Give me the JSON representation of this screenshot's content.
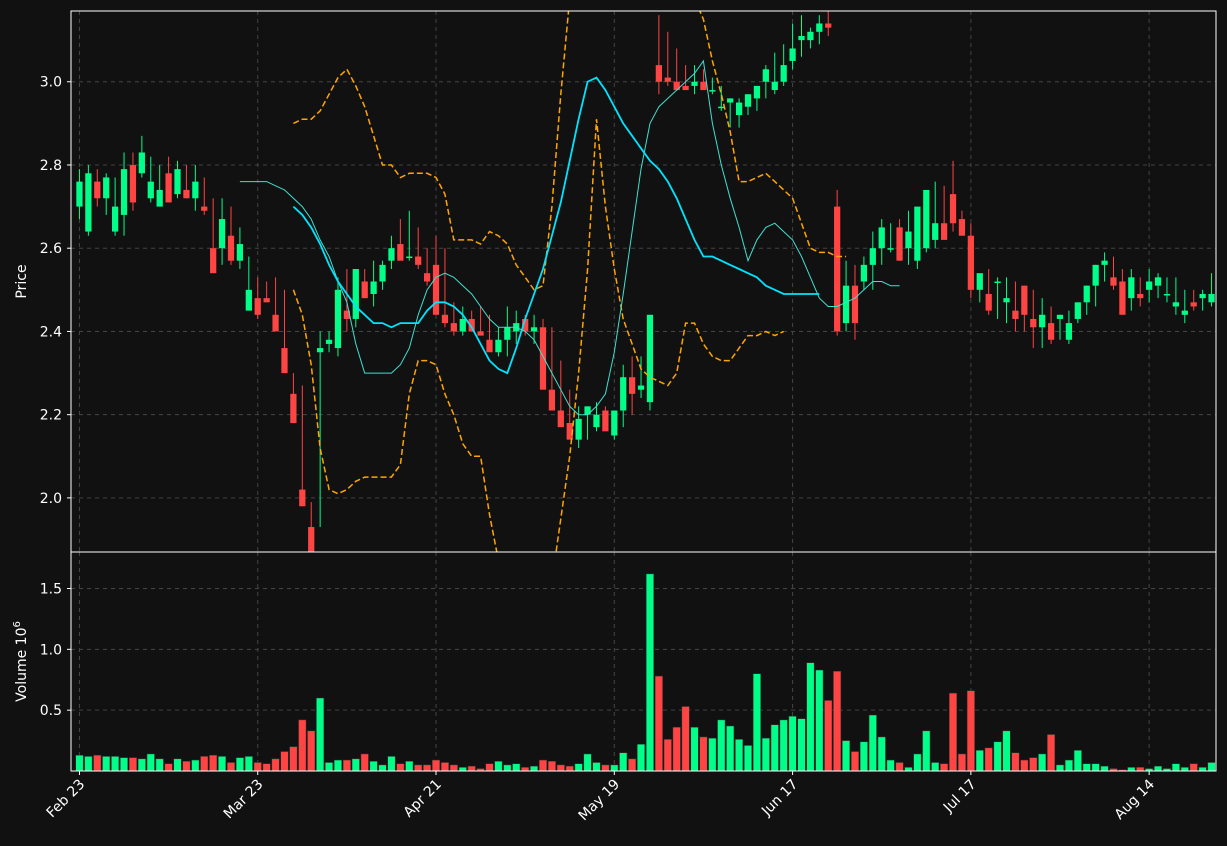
{
  "chart_data": [
    {
      "type": "candlestick",
      "ylabel": "Price",
      "ylim": [
        1.87,
        3.17
      ],
      "yticks": [
        2.0,
        2.2,
        2.4,
        2.6,
        2.8,
        3.0
      ],
      "xticks": [
        "Feb 23",
        "Mar 23",
        "Apr 21",
        "May 19",
        "Jun 17",
        "Jul 17",
        "Aug 14"
      ],
      "grid": true,
      "colors": {
        "up": "#00ff88",
        "down": "#ff4444",
        "ma_fast": "#40e0d0",
        "ma_slow": "#00e5ff",
        "bands": "#ffa500",
        "background": "#111111"
      },
      "open": [
        2.7,
        2.64,
        2.76,
        2.72,
        2.64,
        2.68,
        2.8,
        2.78,
        2.72,
        2.7,
        2.78,
        2.73,
        2.74,
        2.72,
        2.7,
        2.6,
        2.6,
        2.63,
        2.57,
        2.45,
        2.48,
        2.48,
        2.44,
        2.36,
        2.25,
        2.02,
        1.93,
        2.35,
        2.37,
        2.36,
        2.45,
        2.43,
        2.52,
        2.49,
        2.52,
        2.57,
        2.61,
        2.58,
        2.58,
        2.54,
        2.56,
        2.44,
        2.42,
        2.4,
        2.43,
        2.4,
        2.38,
        2.35,
        2.38,
        2.4,
        2.43,
        2.4,
        2.41,
        2.26,
        2.21,
        2.18,
        2.14,
        2.2,
        2.17,
        2.21,
        2.15,
        2.21,
        2.29,
        2.26,
        2.23,
        3.04,
        3.01,
        3.0,
        2.99,
        2.99,
        3.0,
        2.98,
        2.94,
        2.95,
        2.92,
        2.94,
        2.96,
        3.0,
        2.98,
        3.0,
        3.05,
        3.1,
        3.1,
        3.12,
        3.14,
        2.7,
        2.42,
        2.51,
        2.52,
        2.56,
        2.6,
        2.6,
        2.65,
        2.6,
        2.57,
        2.6,
        2.62,
        2.66,
        2.73,
        2.67,
        2.63,
        2.5,
        2.49,
        2.52,
        2.47,
        2.45,
        2.51,
        2.43,
        2.41,
        2.42,
        2.43,
        2.38,
        2.43,
        2.47,
        2.51,
        2.56,
        2.53,
        2.52,
        2.48,
        2.49,
        2.5,
        2.51,
        2.49,
        2.46,
        2.44,
        2.47,
        2.48,
        2.47
      ],
      "high": [
        2.79,
        2.8,
        2.79,
        2.78,
        2.77,
        2.83,
        2.83,
        2.87,
        2.82,
        2.8,
        2.82,
        2.81,
        2.8,
        2.8,
        2.77,
        2.72,
        2.72,
        2.7,
        2.65,
        2.58,
        2.53,
        2.52,
        2.53,
        2.5,
        2.3,
        2.27,
        1.99,
        2.4,
        2.4,
        2.53,
        2.55,
        2.54,
        2.55,
        2.57,
        2.57,
        2.63,
        2.67,
        2.69,
        2.65,
        2.6,
        2.63,
        2.6,
        2.47,
        2.46,
        2.45,
        2.46,
        2.44,
        2.41,
        2.46,
        2.45,
        2.44,
        2.44,
        2.43,
        2.41,
        2.33,
        2.26,
        2.22,
        2.22,
        2.23,
        2.22,
        2.21,
        2.32,
        2.34,
        2.34,
        2.44,
        3.16,
        3.12,
        3.08,
        3.04,
        3.04,
        3.03,
        3.01,
        2.99,
        2.96,
        2.96,
        2.97,
        2.99,
        3.04,
        3.07,
        3.09,
        3.14,
        3.16,
        3.13,
        3.16,
        3.17,
        2.74,
        2.57,
        2.56,
        2.58,
        2.64,
        2.67,
        2.66,
        2.67,
        2.69,
        2.64,
        2.71,
        2.76,
        2.75,
        2.81,
        2.69,
        2.66,
        2.53,
        2.55,
        2.53,
        2.53,
        2.52,
        2.51,
        2.5,
        2.48,
        2.46,
        2.44,
        2.45,
        2.46,
        2.51,
        2.56,
        2.59,
        2.58,
        2.55,
        2.55,
        2.53,
        2.55,
        2.54,
        2.53,
        2.53,
        2.5,
        2.5,
        2.5,
        2.54
      ],
      "low": [
        2.67,
        2.63,
        2.7,
        2.68,
        2.63,
        2.63,
        2.69,
        2.77,
        2.71,
        2.7,
        2.73,
        2.72,
        2.72,
        2.69,
        2.68,
        2.54,
        2.56,
        2.56,
        2.55,
        2.45,
        2.43,
        2.47,
        2.42,
        2.34,
        2.24,
        1.98,
        1.88,
        1.93,
        2.35,
        2.34,
        2.4,
        2.41,
        2.48,
        2.46,
        2.5,
        2.55,
        2.6,
        2.57,
        2.55,
        2.51,
        2.52,
        2.41,
        2.39,
        2.39,
        2.41,
        2.4,
        2.37,
        2.34,
        2.34,
        2.37,
        2.39,
        2.37,
        2.38,
        2.23,
        2.18,
        2.17,
        2.12,
        2.14,
        2.16,
        2.16,
        2.14,
        2.17,
        2.2,
        2.24,
        2.21,
        2.97,
        2.99,
        2.98,
        2.98,
        2.97,
        2.99,
        2.97,
        2.93,
        2.89,
        2.89,
        2.92,
        2.93,
        2.96,
        2.97,
        2.99,
        3.03,
        3.06,
        3.08,
        3.09,
        3.11,
        2.39,
        2.4,
        2.38,
        2.5,
        2.5,
        2.56,
        2.59,
        2.57,
        2.56,
        2.55,
        2.59,
        2.6,
        2.64,
        2.64,
        2.63,
        2.48,
        2.47,
        2.44,
        2.43,
        2.42,
        2.4,
        2.4,
        2.36,
        2.36,
        2.37,
        2.38,
        2.37,
        2.42,
        2.44,
        2.46,
        2.52,
        2.5,
        2.49,
        2.45,
        2.46,
        2.47,
        2.48,
        2.47,
        2.44,
        2.42,
        2.45,
        2.45,
        2.46
      ],
      "close": [
        2.76,
        2.78,
        2.72,
        2.77,
        2.7,
        2.79,
        2.71,
        2.83,
        2.76,
        2.74,
        2.71,
        2.79,
        2.72,
        2.76,
        2.69,
        2.54,
        2.67,
        2.57,
        2.61,
        2.5,
        2.44,
        2.47,
        2.4,
        2.3,
        2.18,
        1.98,
        1.87,
        2.36,
        2.38,
        2.5,
        2.43,
        2.55,
        2.48,
        2.52,
        2.56,
        2.6,
        2.57,
        2.58,
        2.56,
        2.52,
        2.44,
        2.42,
        2.4,
        2.43,
        2.4,
        2.39,
        2.35,
        2.38,
        2.41,
        2.42,
        2.4,
        2.41,
        2.26,
        2.21,
        2.17,
        2.14,
        2.19,
        2.22,
        2.2,
        2.16,
        2.21,
        2.29,
        2.25,
        2.27,
        2.44,
        3.0,
        3.0,
        2.98,
        2.98,
        3.0,
        2.98,
        2.98,
        2.94,
        2.96,
        2.95,
        2.97,
        2.99,
        3.03,
        3.0,
        3.04,
        3.08,
        3.11,
        3.12,
        3.14,
        3.13,
        2.4,
        2.51,
        2.42,
        2.56,
        2.6,
        2.65,
        2.6,
        2.57,
        2.64,
        2.7,
        2.74,
        2.66,
        2.62,
        2.66,
        2.63,
        2.5,
        2.54,
        2.45,
        2.52,
        2.48,
        2.43,
        2.44,
        2.41,
        2.44,
        2.38,
        2.44,
        2.42,
        2.47,
        2.51,
        2.56,
        2.57,
        2.51,
        2.44,
        2.53,
        2.48,
        2.52,
        2.53,
        2.49,
        2.47,
        2.45,
        2.46,
        2.49,
        2.49
      ],
      "ma_fast": [
        2.76,
        2.76,
        2.76,
        2.76,
        2.75,
        2.74,
        2.72,
        2.7,
        2.67,
        2.62,
        2.58,
        2.52,
        2.47,
        2.37,
        2.3,
        2.3,
        2.3,
        2.3,
        2.32,
        2.36,
        2.44,
        2.5,
        2.53,
        2.54,
        2.53,
        2.51,
        2.49,
        2.46,
        2.43,
        2.41,
        2.41,
        2.41,
        2.4,
        2.38,
        2.34,
        2.3,
        2.26,
        2.22,
        2.2,
        2.2,
        2.22,
        2.25,
        2.35,
        2.49,
        2.64,
        2.79,
        2.9,
        2.94,
        2.96,
        2.98,
        3.0,
        3.02,
        3.05,
        2.9,
        2.8,
        2.72,
        2.65,
        2.57,
        2.62,
        2.65,
        2.66,
        2.64,
        2.62,
        2.58,
        2.53,
        2.48,
        2.46,
        2.46,
        2.47,
        2.48,
        2.5,
        2.52,
        2.52,
        2.51,
        2.51
      ],
      "ma_fast_x_offset": 18,
      "ma_slow": [
        2.7,
        2.68,
        2.65,
        2.61,
        2.56,
        2.52,
        2.49,
        2.46,
        2.44,
        2.42,
        2.42,
        2.41,
        2.42,
        2.42,
        2.42,
        2.45,
        2.47,
        2.47,
        2.46,
        2.44,
        2.41,
        2.37,
        2.33,
        2.31,
        2.3,
        2.36,
        2.43,
        2.49,
        2.55,
        2.63,
        2.71,
        2.81,
        2.91,
        3.0,
        3.01,
        2.98,
        2.94,
        2.9,
        2.87,
        2.84,
        2.81,
        2.79,
        2.76,
        2.72,
        2.67,
        2.62,
        2.58,
        2.58,
        2.57,
        2.56,
        2.55,
        2.54,
        2.53,
        2.51,
        2.5,
        2.49,
        2.49,
        2.49,
        2.49,
        2.49
      ],
      "ma_slow_x_offset": 24,
      "band_upper": [
        2.9,
        2.91,
        2.91,
        2.93,
        2.97,
        3.01,
        3.03,
        2.99,
        2.94,
        2.87,
        2.8,
        2.8,
        2.77,
        2.78,
        2.78,
        2.78,
        2.77,
        2.73,
        2.62,
        2.62,
        2.62,
        2.61,
        2.64,
        2.63,
        2.61,
        2.56,
        2.53,
        2.5,
        2.51,
        2.7,
        2.97,
        3.2,
        3.4,
        3.5,
        3.6,
        3.7,
        3.8,
        3.9,
        3.9,
        3.8,
        3.7,
        3.6,
        3.5,
        3.4,
        3.3,
        3.2,
        3.15,
        3.05,
        2.97,
        2.88,
        2.76,
        2.76,
        2.77,
        2.78,
        2.76,
        2.74,
        2.72,
        2.66,
        2.6,
        2.59,
        2.59,
        2.58,
        2.58
      ],
      "band_upper_x_offset": 24,
      "band_lower": [
        2.5,
        2.44,
        2.32,
        2.12,
        2.02,
        2.01,
        2.02,
        2.04,
        2.05,
        2.05,
        2.05,
        2.05,
        2.08,
        2.25,
        2.33,
        2.33,
        2.32,
        2.25,
        2.2,
        2.13,
        2.1,
        2.1,
        1.96,
        1.85,
        1.75,
        1.65,
        1.62,
        1.64,
        1.7,
        1.8,
        1.95,
        2.1,
        2.3,
        2.55,
        2.91,
        2.7,
        2.55,
        2.43,
        2.37,
        2.31,
        2.29,
        2.28,
        2.27,
        2.3,
        2.42,
        2.42,
        2.37,
        2.34,
        2.33,
        2.33,
        2.36,
        2.39,
        2.39,
        2.4,
        2.39,
        2.4
      ],
      "band_lower_x_offset": 24
    },
    {
      "type": "bar",
      "ylabel": "Volume",
      "yunit_exponent": "6",
      "ylim": [
        0,
        1.8
      ],
      "yticks": [
        0.5,
        1.0,
        1.5
      ],
      "grid": true,
      "values": [
        0.13,
        0.12,
        0.13,
        0.12,
        0.12,
        0.11,
        0.11,
        0.1,
        0.14,
        0.1,
        0.06,
        0.1,
        0.08,
        0.09,
        0.12,
        0.13,
        0.12,
        0.07,
        0.11,
        0.12,
        0.07,
        0.06,
        0.1,
        0.16,
        0.2,
        0.42,
        0.33,
        0.6,
        0.07,
        0.09,
        0.09,
        0.1,
        0.14,
        0.08,
        0.05,
        0.12,
        0.06,
        0.08,
        0.05,
        0.05,
        0.09,
        0.07,
        0.05,
        0.03,
        0.04,
        0.02,
        0.06,
        0.08,
        0.05,
        0.06,
        0.03,
        0.04,
        0.09,
        0.08,
        0.05,
        0.04,
        0.06,
        0.14,
        0.07,
        0.05,
        0.05,
        0.15,
        0.1,
        0.22,
        1.62,
        0.78,
        0.26,
        0.36,
        0.53,
        0.36,
        0.28,
        0.27,
        0.42,
        0.37,
        0.26,
        0.21,
        0.8,
        0.27,
        0.38,
        0.42,
        0.45,
        0.43,
        0.89,
        0.83,
        0.58,
        0.82,
        0.25,
        0.16,
        0.24,
        0.46,
        0.28,
        0.09,
        0.07,
        0.03,
        0.14,
        0.33,
        0.07,
        0.06,
        0.64,
        0.14,
        0.66,
        0.17,
        0.19,
        0.24,
        0.33,
        0.15,
        0.09,
        0.11,
        0.14,
        0.3,
        0.05,
        0.09,
        0.17,
        0.06,
        0.06,
        0.04,
        0.02,
        0.01,
        0.03,
        0.03,
        0.02,
        0.04,
        0.02,
        0.06,
        0.03,
        0.06,
        0.03,
        0.07
      ]
    }
  ]
}
